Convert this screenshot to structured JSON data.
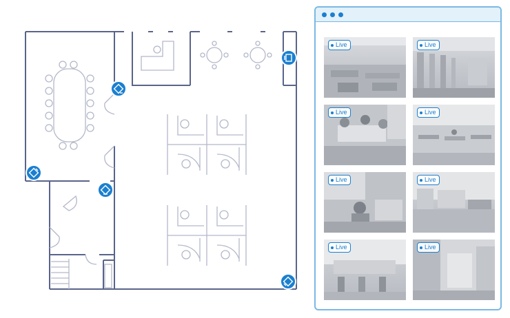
{
  "colors": {
    "accent": "#1b7fd0",
    "window_border": "#7ab8e3",
    "wall": "#59638a"
  },
  "floorplan": {
    "cameras": [
      {
        "name": "camera-meeting-room"
      },
      {
        "name": "camera-lounge"
      },
      {
        "name": "camera-corner-southwest"
      },
      {
        "name": "camera-hallway"
      },
      {
        "name": "camera-corner-southeast"
      }
    ]
  },
  "monitor": {
    "window_controls": [
      "close",
      "minimize",
      "maximize"
    ],
    "feeds": [
      {
        "live_label": "Live",
        "scene": "open-office"
      },
      {
        "live_label": "Live",
        "scene": "warehouse"
      },
      {
        "live_label": "Live",
        "scene": "meeting"
      },
      {
        "live_label": "Live",
        "scene": "office-floor"
      },
      {
        "live_label": "Live",
        "scene": "lounge"
      },
      {
        "live_label": "Live",
        "scene": "workstations"
      },
      {
        "live_label": "Live",
        "scene": "reception"
      },
      {
        "live_label": "Live",
        "scene": "corridor"
      }
    ]
  }
}
